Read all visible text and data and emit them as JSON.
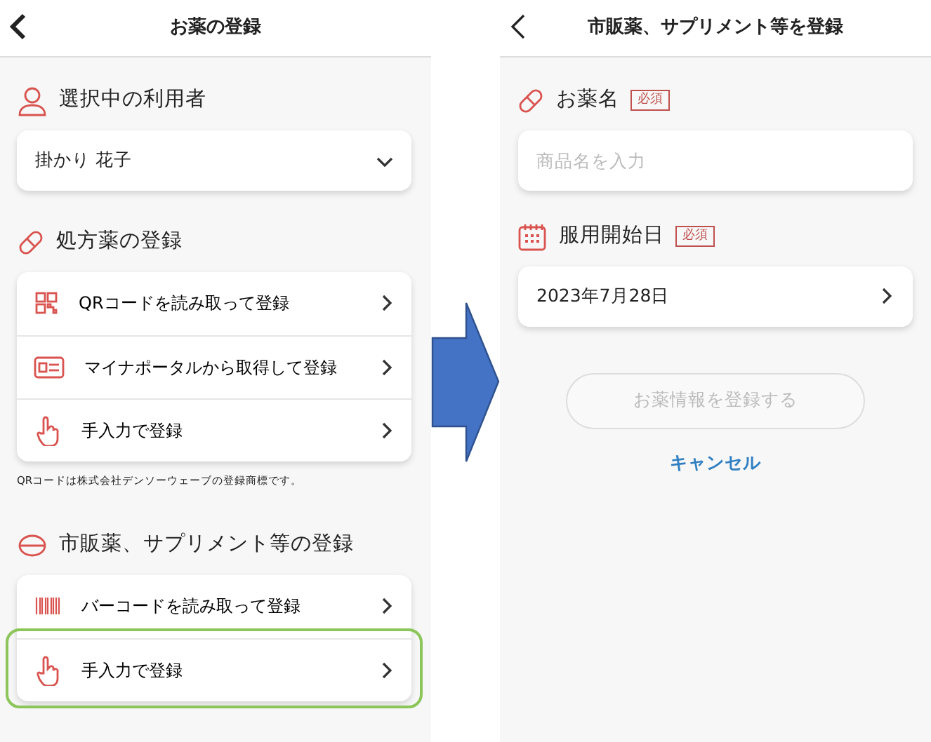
{
  "left_screen": {
    "title": "お薬の登録",
    "sections": [
      {
        "kind": "select",
        "heading": "選択中の利用者",
        "value": "掛かり 花子"
      },
      {
        "kind": "menu",
        "heading": "処方薬の登録",
        "items": [
          {
            "label": "QRコードを読み取って登録",
            "highlighted": false
          },
          {
            "label": "マイナポータルから取得して登録",
            "highlighted": false
          },
          {
            "label": "手入力で登録",
            "highlighted": false
          }
        ],
        "note": "QRコードは株式会社デンソーウェーブの登録商標です。"
      },
      {
        "kind": "menu",
        "heading": "市販薬、サプリメント等の登録",
        "items": [
          {
            "label": "バーコードを読み取って登録",
            "highlighted": false
          },
          {
            "label": "手入力で登録",
            "highlighted": true
          }
        ]
      }
    ]
  },
  "right_screen": {
    "title": "市販薬、サプリメント等を登録",
    "fields": [
      {
        "kind": "text",
        "label": "お薬名",
        "badge": "必須",
        "placeholder": "商品名を入力"
      },
      {
        "kind": "date",
        "label": "服用開始日",
        "badge": "必須",
        "value": "2023年7月28日"
      }
    ],
    "submit": {
      "label": "お薬情報を登録する",
      "disabled": true
    },
    "cancel": "キャンセル"
  }
}
